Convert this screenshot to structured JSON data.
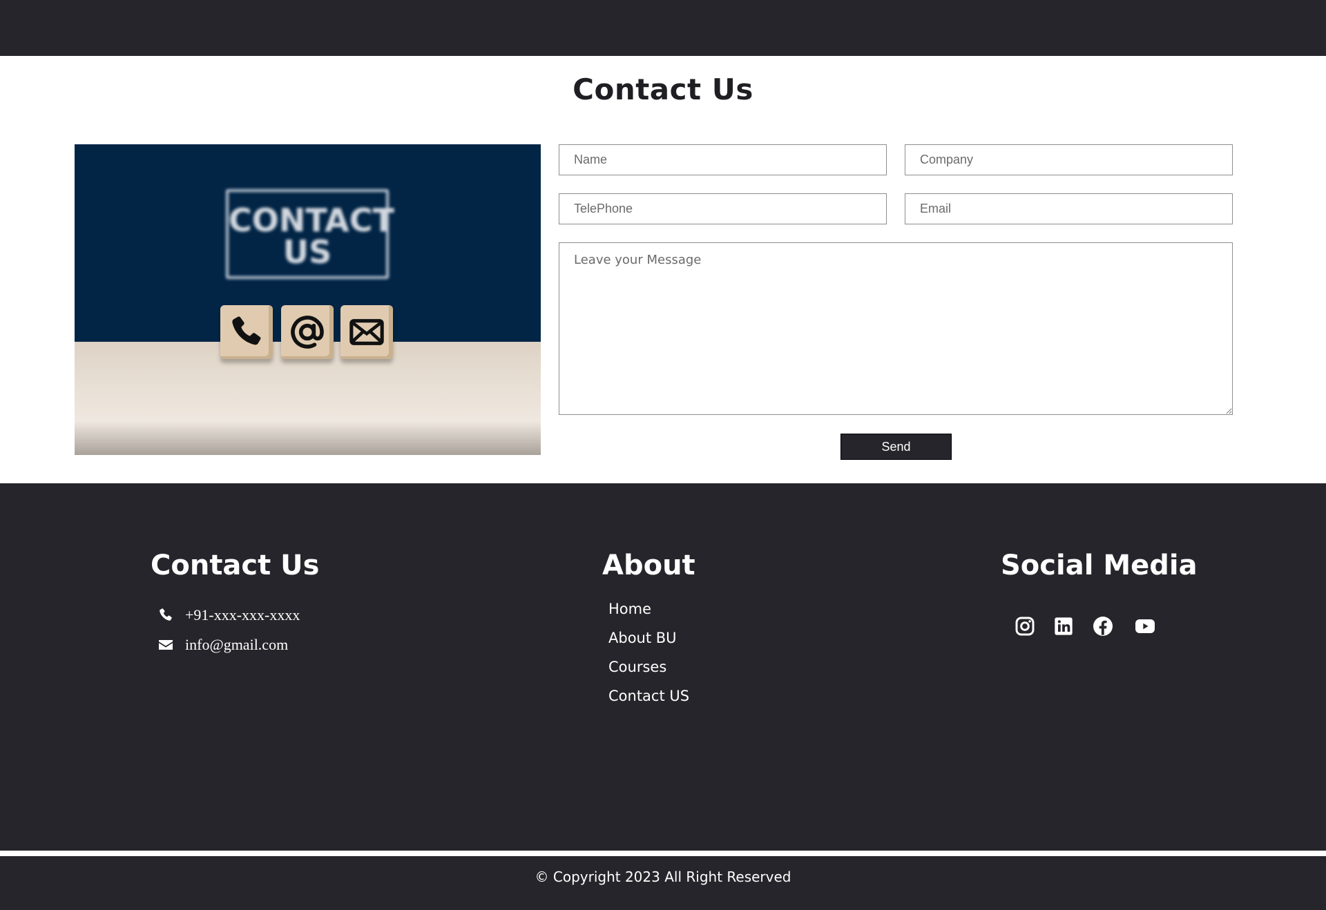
{
  "page": {
    "title": "Contact Us"
  },
  "hero_image": {
    "sign_text_line1": "CONTACT",
    "sign_text_line2": "US",
    "cubes": [
      "phone-icon",
      "at-sign-icon",
      "envelope-icon"
    ]
  },
  "form": {
    "name_placeholder": "Name",
    "company_placeholder": "Company",
    "telephone_placeholder": "TelePhone",
    "email_placeholder": "Email",
    "message_placeholder": "Leave your Message",
    "send_label": "Send"
  },
  "footer": {
    "contact": {
      "heading": "Contact Us",
      "phone": "+91-xxx-xxx-xxxx",
      "email": "info@gmail.com"
    },
    "about": {
      "heading": "About",
      "links": [
        "Home",
        "About BU",
        "Courses",
        "Contact US"
      ]
    },
    "social": {
      "heading": "Social Media",
      "icons": [
        "instagram-icon",
        "linkedin-icon",
        "facebook-icon",
        "youtube-icon"
      ]
    },
    "copyright": "© Copyright 2023 All Right Reserved"
  },
  "colors": {
    "dark": "#26252b",
    "wall": "#022546",
    "white": "#ffffff"
  }
}
